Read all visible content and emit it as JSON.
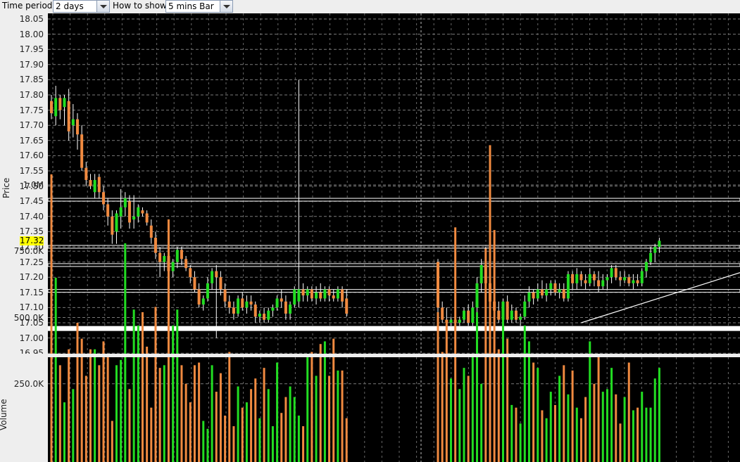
{
  "toolbar": {
    "time_period_label": "Time period",
    "time_period_value": "2 days",
    "how_to_show_label": "How to show",
    "how_to_show_value": "5 mins Bar"
  },
  "price_panel": {
    "axis_title": "Price",
    "ticks": [
      "18.05",
      "18.00",
      "17.95",
      "17.90",
      "17.85",
      "17.80",
      "17.75",
      "17.70",
      "17.65",
      "17.60",
      "17.55",
      "17.50",
      "17.45",
      "17.40",
      "17.35",
      "17.30",
      "17.25",
      "17.20",
      "17.15",
      "17.10",
      "17.05",
      "17.00",
      "16.95"
    ],
    "current_price": "17.32"
  },
  "volume_panel": {
    "axis_title": "Volume",
    "ticks": [
      "1.0M",
      "750.0K",
      "500.0K",
      "250.0K"
    ]
  },
  "colors": {
    "background": "#000000",
    "up": "#22dd22",
    "down": "#f08a40",
    "neutral": "#ffff00",
    "wick": "#ffffff",
    "current_price_tag": "#ffff00"
  },
  "chart_data": {
    "type": "candlestick",
    "x_interval": "5 mins",
    "period": "2 days",
    "ylim": [
      16.95,
      18.05
    ],
    "volume_ylim": [
      0,
      1150000
    ],
    "horizontal_levels": [
      17.455,
      17.3,
      17.24,
      17.155
    ],
    "support_band": 17.03,
    "trendline": {
      "from": [
        33,
        17.05
      ],
      "to": [
        47,
        17.21
      ]
    },
    "day_sessions": [
      {
        "name": "day1",
        "candles": [
          [
            17.78,
            17.8,
            17.72,
            17.74
          ],
          [
            17.73,
            17.83,
            17.7,
            17.79
          ],
          [
            17.79,
            17.8,
            17.72,
            17.75
          ],
          [
            17.76,
            17.8,
            17.7,
            17.79
          ],
          [
            17.78,
            17.82,
            17.65,
            17.68
          ],
          [
            17.7,
            17.77,
            17.66,
            17.72
          ],
          [
            17.72,
            17.74,
            17.62,
            17.67
          ],
          [
            17.67,
            17.7,
            17.55,
            17.56
          ],
          [
            17.56,
            17.58,
            17.5,
            17.52
          ],
          [
            17.52,
            17.54,
            17.49,
            17.5
          ],
          [
            17.48,
            17.54,
            17.46,
            17.52
          ],
          [
            17.53,
            17.54,
            17.46,
            17.48
          ],
          [
            17.48,
            17.5,
            17.42,
            17.44
          ],
          [
            17.44,
            17.46,
            17.37,
            17.4
          ],
          [
            17.4,
            17.42,
            17.31,
            17.34
          ],
          [
            17.35,
            17.42,
            17.31,
            17.41
          ],
          [
            17.4,
            17.49,
            17.36,
            17.43
          ],
          [
            17.43,
            17.48,
            17.4,
            17.46
          ],
          [
            17.45,
            17.47,
            17.36,
            17.38
          ],
          [
            17.39,
            17.47,
            17.36,
            17.4
          ],
          [
            17.4,
            17.44,
            17.38,
            17.43
          ],
          [
            17.42,
            17.43,
            17.4,
            17.41
          ],
          [
            17.41,
            17.42,
            17.37,
            17.38
          ],
          [
            17.37,
            17.39,
            17.31,
            17.33
          ],
          [
            17.33,
            17.35,
            17.26,
            17.28
          ],
          [
            17.28,
            17.3,
            17.2,
            17.25
          ],
          [
            17.25,
            17.28,
            17.22,
            17.27
          ],
          [
            17.27,
            17.3,
            17.2,
            17.22
          ],
          [
            17.22,
            17.26,
            17.2,
            17.25
          ],
          [
            17.25,
            17.3,
            17.23,
            17.29
          ],
          [
            17.29,
            17.3,
            17.24,
            17.26
          ],
          [
            17.26,
            17.27,
            17.22,
            17.23
          ],
          [
            17.23,
            17.24,
            17.18,
            17.2
          ],
          [
            17.2,
            17.22,
            17.15,
            17.16
          ],
          [
            17.16,
            17.18,
            17.1,
            17.11
          ],
          [
            17.11,
            17.14,
            17.09,
            17.13
          ],
          [
            17.13,
            17.2,
            17.12,
            17.18
          ],
          [
            17.18,
            17.23,
            17.16,
            17.22
          ],
          [
            17.22,
            17.24,
            17.0,
            17.2
          ],
          [
            17.2,
            17.22,
            17.14,
            17.16
          ],
          [
            17.16,
            17.18,
            17.1,
            17.12
          ],
          [
            17.12,
            17.14,
            17.08,
            17.1
          ],
          [
            17.1,
            17.12,
            17.06,
            17.08
          ],
          [
            17.08,
            17.14,
            17.07,
            17.13
          ],
          [
            17.13,
            17.15,
            17.09,
            17.1
          ],
          [
            17.1,
            17.14,
            17.08,
            17.12
          ],
          [
            17.12,
            17.14,
            17.09,
            17.11
          ],
          [
            17.11,
            17.12,
            17.05,
            17.07
          ],
          [
            17.07,
            17.09,
            17.05,
            17.08
          ],
          [
            17.08,
            17.1,
            17.05,
            17.06
          ],
          [
            17.06,
            17.1,
            17.05,
            17.09
          ],
          [
            17.09,
            17.11,
            17.07,
            17.1
          ],
          [
            17.1,
            17.14,
            17.09,
            17.13
          ],
          [
            17.13,
            17.16,
            17.1,
            17.12
          ],
          [
            17.12,
            17.14,
            17.06,
            17.08
          ],
          [
            17.08,
            17.12,
            17.06,
            17.11
          ],
          [
            17.11,
            17.17,
            17.1,
            17.16
          ],
          [
            17.12,
            17.85,
            17.1,
            17.16
          ],
          [
            17.16,
            17.18,
            17.12,
            17.14
          ],
          [
            17.14,
            17.17,
            17.12,
            17.16
          ],
          [
            17.16,
            17.17,
            17.12,
            17.13
          ],
          [
            17.13,
            17.17,
            17.11,
            17.15
          ],
          [
            17.15,
            17.18,
            17.12,
            17.13
          ],
          [
            17.13,
            17.17,
            17.12,
            17.16
          ],
          [
            17.16,
            17.17,
            17.12,
            17.14
          ],
          [
            17.14,
            17.16,
            17.12,
            17.13
          ],
          [
            17.13,
            17.17,
            17.12,
            17.16
          ],
          [
            17.16,
            17.17,
            17.1,
            17.12
          ],
          [
            17.13,
            17.16,
            17.07,
            17.08
          ]
        ]
      },
      {
        "name": "day2",
        "candles": [
          [
            17.25,
            17.26,
            17.04,
            17.1
          ],
          [
            17.1,
            17.12,
            17.05,
            17.06
          ],
          [
            17.06,
            17.1,
            17.04,
            17.05
          ],
          [
            17.05,
            17.07,
            17.04,
            17.06
          ],
          [
            17.06,
            17.07,
            17.04,
            17.05
          ],
          [
            17.05,
            17.07,
            17.04,
            17.06
          ],
          [
            17.06,
            17.1,
            17.05,
            17.09
          ],
          [
            17.09,
            17.11,
            17.04,
            17.05
          ],
          [
            17.05,
            17.12,
            17.04,
            17.1
          ],
          [
            17.1,
            17.2,
            17.08,
            17.18
          ],
          [
            17.18,
            17.26,
            17.15,
            17.24
          ],
          [
            17.24,
            17.3,
            17.16,
            17.18
          ],
          [
            17.18,
            17.23,
            17.05,
            17.12
          ],
          [
            17.12,
            17.15,
            17.07,
            17.09
          ],
          [
            17.09,
            17.12,
            17.05,
            17.06
          ],
          [
            17.06,
            17.13,
            17.05,
            17.12
          ],
          [
            17.12,
            17.14,
            17.05,
            17.06
          ],
          [
            17.06,
            17.11,
            17.05,
            17.09
          ],
          [
            17.09,
            17.1,
            17.05,
            17.06
          ],
          [
            17.06,
            17.08,
            17.04,
            17.07
          ],
          [
            17.07,
            17.14,
            17.06,
            17.12
          ],
          [
            17.12,
            17.17,
            17.1,
            17.15
          ],
          [
            17.15,
            17.16,
            17.11,
            17.13
          ],
          [
            17.13,
            17.18,
            17.12,
            17.16
          ],
          [
            17.16,
            17.19,
            17.13,
            17.14
          ],
          [
            17.14,
            17.18,
            17.12,
            17.16
          ],
          [
            17.16,
            17.19,
            17.14,
            17.18
          ],
          [
            17.18,
            17.19,
            17.14,
            17.15
          ],
          [
            17.15,
            17.18,
            17.13,
            17.16
          ],
          [
            17.16,
            17.18,
            17.12,
            17.13
          ],
          [
            17.13,
            17.22,
            17.12,
            17.21
          ],
          [
            17.21,
            17.22,
            17.16,
            17.18
          ],
          [
            17.18,
            17.23,
            17.16,
            17.21
          ],
          [
            17.21,
            17.22,
            17.17,
            17.19
          ],
          [
            17.19,
            17.21,
            17.16,
            17.18
          ],
          [
            17.18,
            17.23,
            17.17,
            17.21
          ],
          [
            17.21,
            17.22,
            17.17,
            17.19
          ],
          [
            17.19,
            17.22,
            17.15,
            17.17
          ],
          [
            17.17,
            17.21,
            17.16,
            17.19
          ],
          [
            17.19,
            17.21,
            17.16,
            17.2
          ],
          [
            17.2,
            17.24,
            17.18,
            17.23
          ],
          [
            17.23,
            17.24,
            17.19,
            17.2
          ],
          [
            17.2,
            17.22,
            17.17,
            17.19
          ],
          [
            17.19,
            17.22,
            17.18,
            17.2
          ],
          [
            17.2,
            17.21,
            17.17,
            17.18
          ],
          [
            17.18,
            17.21,
            17.16,
            17.19
          ],
          [
            17.19,
            17.21,
            17.17,
            17.18
          ],
          [
            17.18,
            17.23,
            17.17,
            17.22
          ],
          [
            17.22,
            17.26,
            17.2,
            17.25
          ],
          [
            17.25,
            17.3,
            17.24,
            17.28
          ],
          [
            17.28,
            17.31,
            17.25,
            17.3
          ],
          [
            17.3,
            17.33,
            17.28,
            17.32
          ]
        ]
      }
    ],
    "volume": {
      "day1": [
        1040000,
        650000,
        320000,
        180000,
        380000,
        230000,
        480000,
        420000,
        280000,
        380000,
        380000,
        320000,
        410000,
        360000,
        110000,
        320000,
        340000,
        780000,
        230000,
        530000,
        470000,
        520000,
        390000,
        160000,
        540000,
        310000,
        320000,
        870000,
        470000,
        530000,
        320000,
        250000,
        180000,
        320000,
        330000,
        110000,
        80000,
        320000,
        220000,
        290000,
        130000,
        370000,
        90000,
        240000,
        160000,
        180000,
        230000,
        270000,
        120000,
        310000,
        230000,
        90000,
        330000,
        140000,
        200000,
        240000,
        200000,
        130000,
        90000,
        350000,
        370000,
        280000,
        400000,
        410000,
        280000,
        420000,
        300000,
        300000,
        120000,
        140000,
        520000,
        330000,
        210000,
        60000,
        530000,
        200000,
        260000,
        500000,
        440000,
        480000,
        620000,
        480000,
        840000
      ],
      "day2": [
        520000,
        370000,
        480000,
        270000,
        840000,
        230000,
        310000,
        280000,
        360000,
        520000,
        250000,
        760000,
        1150000,
        830000,
        380000,
        530000,
        420000,
        170000,
        160000,
        100000,
        470000,
        410000,
        330000,
        310000,
        150000,
        120000,
        220000,
        170000,
        280000,
        320000,
        210000,
        300000,
        160000,
        120000,
        200000,
        410000,
        250000,
        360000,
        220000,
        230000,
        310000,
        210000,
        100000,
        200000,
        330000,
        150000,
        160000,
        220000,
        160000,
        160000,
        270000,
        310000
      ]
    }
  }
}
